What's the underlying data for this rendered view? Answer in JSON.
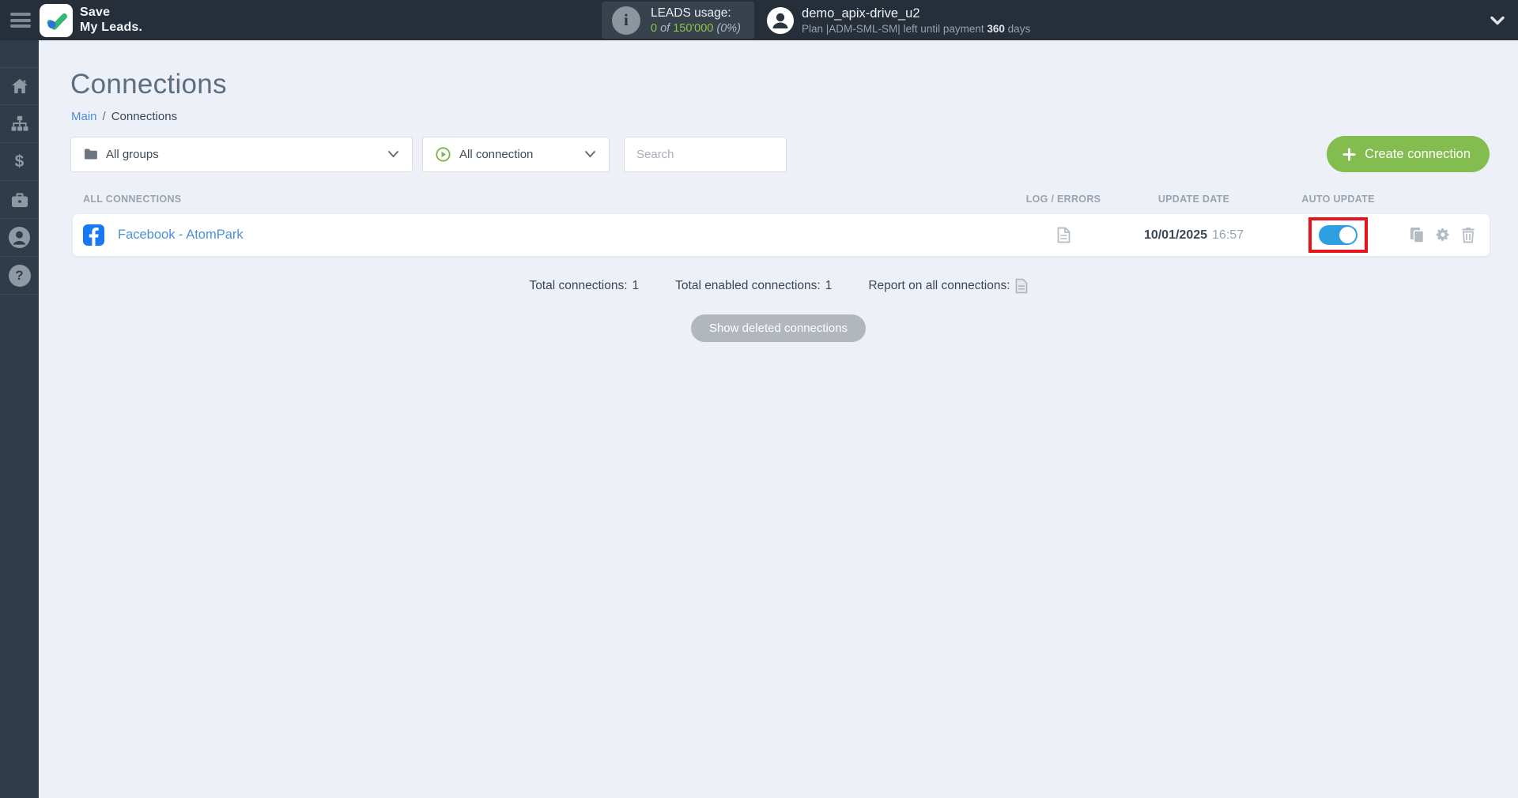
{
  "header": {
    "brand": {
      "line1": "Save",
      "line2": "My Leads."
    },
    "leads_usage": {
      "label": "LEADS usage:",
      "used": "0",
      "of_word": "of",
      "total": "150'000",
      "percent": "(0%)"
    },
    "user": {
      "name": "demo_apix-drive_u2",
      "plan_text": "Plan |ADM-SML-SM| left until payment",
      "days": "360",
      "days_word": "days"
    }
  },
  "icons": {
    "info_glyph": "i",
    "billing_glyph": "$",
    "help_glyph": "?"
  },
  "sidebar": {
    "items": [
      "home",
      "connections",
      "billing",
      "services",
      "account",
      "help"
    ]
  },
  "page": {
    "title": "Connections",
    "breadcrumb": {
      "root": "Main",
      "separator": "/",
      "current": "Connections"
    }
  },
  "filters": {
    "groups_value": "All groups",
    "connection_value": "All connection",
    "search_placeholder": "Search",
    "create_label": "Create connection"
  },
  "table": {
    "headers": {
      "all_connections": "ALL CONNECTIONS",
      "log_errors": "LOG / ERRORS",
      "update_date": "UPDATE DATE",
      "auto_update": "AUTO UPDATE"
    },
    "row": {
      "name": "Facebook - AtomPark",
      "date": "10/01/2025",
      "time": "16:57",
      "auto_update": "on"
    }
  },
  "summary": {
    "total_label": "Total connections:",
    "total_value": "1",
    "enabled_label": "Total enabled connections:",
    "enabled_value": "1",
    "report_label": "Report on all connections:"
  },
  "buttons": {
    "show_deleted": "Show deleted connections"
  },
  "colors": {
    "header-bg": "#252e39",
    "sidebar-bg": "#2f3d4b",
    "content-bg": "#edf1f7",
    "accent-green": "#84bd4f",
    "link-blue": "#4a90d9",
    "toggle-blue": "#2e9fe0",
    "facebook-blue": "#1877f2",
    "annotation-red": "#e8141c"
  }
}
